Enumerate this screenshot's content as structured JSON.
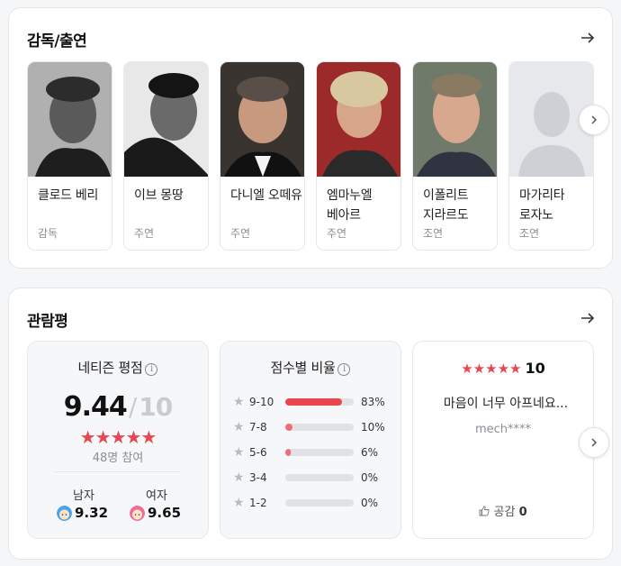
{
  "cast_section": {
    "title": "감독/출연",
    "people": [
      {
        "name": "클로드 베리",
        "role": "감독"
      },
      {
        "name": "이브 몽땅",
        "role": "주연"
      },
      {
        "name": "다니엘 오떼유",
        "role": "주연"
      },
      {
        "name": "엠마누엘 베아르",
        "role": "주연"
      },
      {
        "name": "이폴리트 지라르도",
        "role": "조연"
      },
      {
        "name": "마가리타 로자노",
        "role": "조연"
      }
    ]
  },
  "review_section": {
    "title": "관람평",
    "netizen": {
      "title": "네티즌 평점",
      "score": "9.44",
      "separator": "/",
      "max": "10",
      "stars": "★★★★★",
      "participants": "48명 참여",
      "male_label": "남자",
      "male_score": "9.32",
      "female_label": "여자",
      "female_score": "9.65"
    },
    "distribution": {
      "title": "점수별 비율",
      "rows": [
        {
          "range": "9-10",
          "percent": 83,
          "label": "83%"
        },
        {
          "range": "7-8",
          "percent": 10,
          "label": "10%"
        },
        {
          "range": "5-6",
          "percent": 6,
          "label": "6%"
        },
        {
          "range": "3-4",
          "percent": 0,
          "label": "0%"
        },
        {
          "range": "1-2",
          "percent": 0,
          "label": "0%"
        }
      ]
    },
    "review": {
      "stars": "★★★★★",
      "score": "10",
      "text": "마음이 너무 아프네요...",
      "user": "mech****",
      "like_label": "공감",
      "like_count": "0"
    }
  },
  "colors": {
    "accent_red": "#e8474f",
    "male_blue": "#4aa3e8",
    "female_pink": "#f06a9a"
  }
}
